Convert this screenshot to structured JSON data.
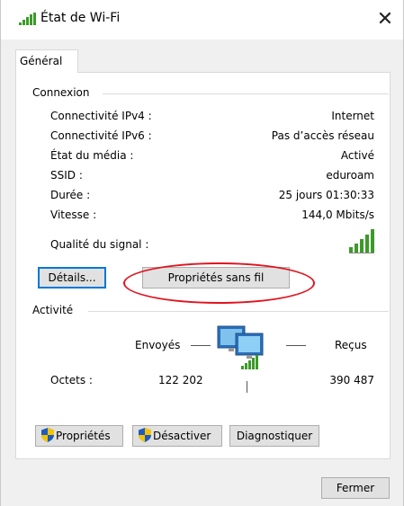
{
  "window": {
    "title": "État de Wi-Fi",
    "close_glyph": "✕",
    "icon": "wifi-signal-icon"
  },
  "tabs": [
    {
      "label": "Général",
      "selected": true
    }
  ],
  "connexion": {
    "heading": "Connexion",
    "rows": [
      {
        "label": "Connectivité IPv4 :",
        "value": "Internet"
      },
      {
        "label": "Connectivité IPv6 :",
        "value": "Pas d’accès réseau"
      },
      {
        "label": "État du média :",
        "value": "Activé"
      },
      {
        "label": "SSID :",
        "value": "eduroam"
      },
      {
        "label": "Durée :",
        "value": "25 jours 01:30:33"
      },
      {
        "label": "Vitesse :",
        "value": "144,0 Mbits/s"
      }
    ],
    "signal_label": "Qualité du signal :",
    "signal_bars_filled": 5,
    "signal_bars_total": 5,
    "details_button": "Détails...",
    "wireless_props_button": "Propriétés sans fil"
  },
  "activite": {
    "heading": "Activité",
    "sent_label": "Envoyés",
    "received_label": "Reçus",
    "bytes_label": "Octets :",
    "bytes_sent": "122 202",
    "bytes_received": "390 487"
  },
  "buttons": {
    "properties": "Propriétés",
    "disable": "Désactiver",
    "diagnose": "Diagnostiquer",
    "close": "Fermer"
  },
  "colors": {
    "signal_green": "#3c9a2a",
    "highlight_red": "#e0141e",
    "focus_blue": "#0078d7",
    "shield_blue": "#1e5bbf",
    "shield_yellow": "#f5c400"
  }
}
